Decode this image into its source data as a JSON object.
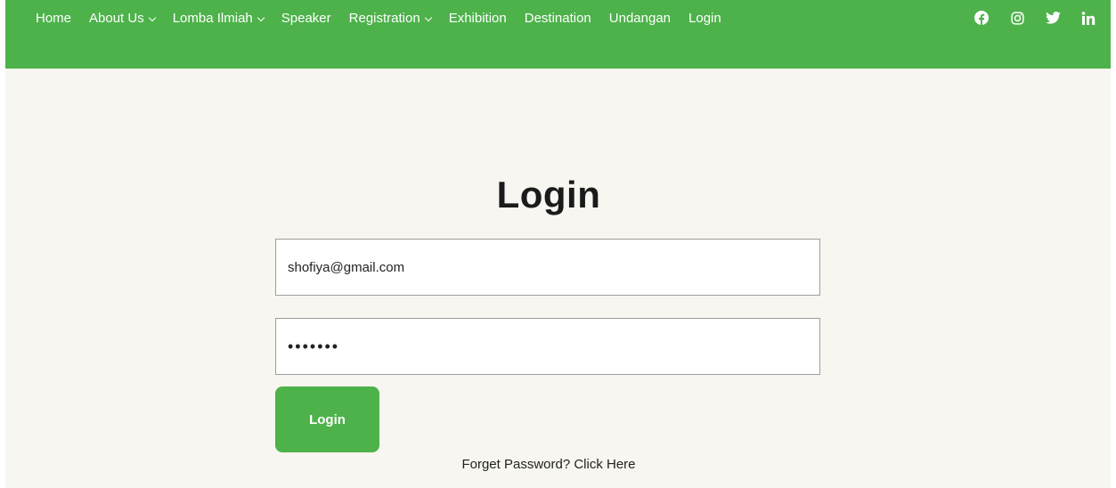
{
  "navbar": {
    "items": [
      {
        "label": "Home",
        "dropdown": false
      },
      {
        "label": "About Us",
        "dropdown": true
      },
      {
        "label": "Lomba Ilmiah",
        "dropdown": true
      },
      {
        "label": "Speaker",
        "dropdown": false
      },
      {
        "label": "Registration",
        "dropdown": true
      },
      {
        "label": "Exhibition",
        "dropdown": false
      },
      {
        "label": "Destination",
        "dropdown": false
      },
      {
        "label": "Undangan",
        "dropdown": false
      },
      {
        "label": "Login",
        "dropdown": false
      }
    ],
    "social_icons": [
      "facebook-icon",
      "instagram-icon",
      "twitter-icon",
      "linkedin-icon"
    ],
    "background_color": "#4db24a"
  },
  "login_form": {
    "title": "Login",
    "email_value": "shofiya@gmail.com",
    "password_value": "•••••••",
    "submit_label": "Login",
    "forget_text": "Forget Password? Click Here"
  },
  "colors": {
    "accent": "#4db24a",
    "page_background": "#f7f6f0"
  }
}
